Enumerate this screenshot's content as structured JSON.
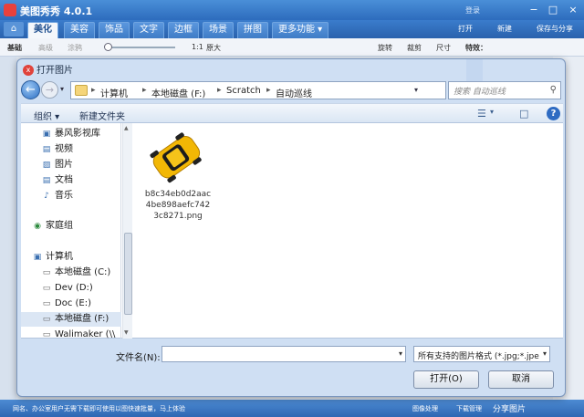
{
  "app": {
    "title": "美图秀秀 4.0.1",
    "title_extra": "登录",
    "window_controls": [
      "−",
      "□",
      "×"
    ],
    "home_icon": "home-icon",
    "tabs": [
      {
        "label": "美化",
        "active": true
      },
      {
        "label": "美容",
        "active": false
      },
      {
        "label": "饰品",
        "active": false
      },
      {
        "label": "文字",
        "active": false
      },
      {
        "label": "边框",
        "active": false
      },
      {
        "label": "场景",
        "active": false
      },
      {
        "label": "拼图",
        "active": false
      },
      {
        "label": "更多功能 ▾",
        "active": false
      }
    ],
    "right_buttons": {
      "open": "打开",
      "new": "新建",
      "save": "保存与分享"
    },
    "toolbar": {
      "basic": "基础",
      "advanced": "高级",
      "graffiti": "涂鸦",
      "ratio": "1:1",
      "fit": "原大",
      "rotate": "旋转",
      "crop": "裁剪",
      "resize": "尺寸",
      "effects": "特效："
    },
    "status": {
      "left": "网名、办公室用户无需下载即可使用以图快速批量，马上体验",
      "mid": "图像处理",
      "right": "下载管理",
      "share": "分享图片"
    }
  },
  "dialog": {
    "title": "打开图片",
    "breadcrumbs": [
      "计算机",
      "本地磁盘 (F:)",
      "Scratch",
      "自动巡线"
    ],
    "search_placeholder": "搜索 自动巡线",
    "commands": {
      "organize": "组织 ▾",
      "new_folder": "新建文件夹"
    },
    "nav_items": [
      {
        "label": "暴风影视库",
        "icon": "video-library-icon",
        "glyph": "▣"
      },
      {
        "label": "视频",
        "icon": "video-icon",
        "glyph": "▤"
      },
      {
        "label": "图片",
        "icon": "picture-icon",
        "glyph": "▨"
      },
      {
        "label": "文档",
        "icon": "document-icon",
        "glyph": "▤"
      },
      {
        "label": "音乐",
        "icon": "music-icon",
        "glyph": "♪"
      },
      {
        "label": "家庭组",
        "icon": "homegroup-icon",
        "glyph": "◉"
      },
      {
        "label": "计算机",
        "icon": "computer-icon",
        "glyph": "▣"
      },
      {
        "label": "本地磁盘 (C:)",
        "icon": "drive-icon",
        "glyph": "▭"
      },
      {
        "label": "Dev (D:)",
        "icon": "drive-icon",
        "glyph": "▭"
      },
      {
        "label": "Doc (E:)",
        "icon": "drive-icon",
        "glyph": "▭"
      },
      {
        "label": "本地磁盘 (F:)",
        "icon": "drive-icon",
        "glyph": "▭",
        "selected": true
      },
      {
        "label": "Walimaker (\\\\",
        "icon": "network-drive-icon",
        "glyph": "▭"
      }
    ],
    "file": {
      "name_line1": "b8c34eb0d2aac",
      "name_line2": "4be898aefc742",
      "name_line3": "3c8271.png",
      "icon": "car-image-thumbnail"
    },
    "filename_label": "文件名(N):",
    "filename_value": "",
    "filetype": "所有支持的图片格式 (*.jpg;*.jpe",
    "open_button": "打开(O)",
    "cancel_button": "取消"
  }
}
